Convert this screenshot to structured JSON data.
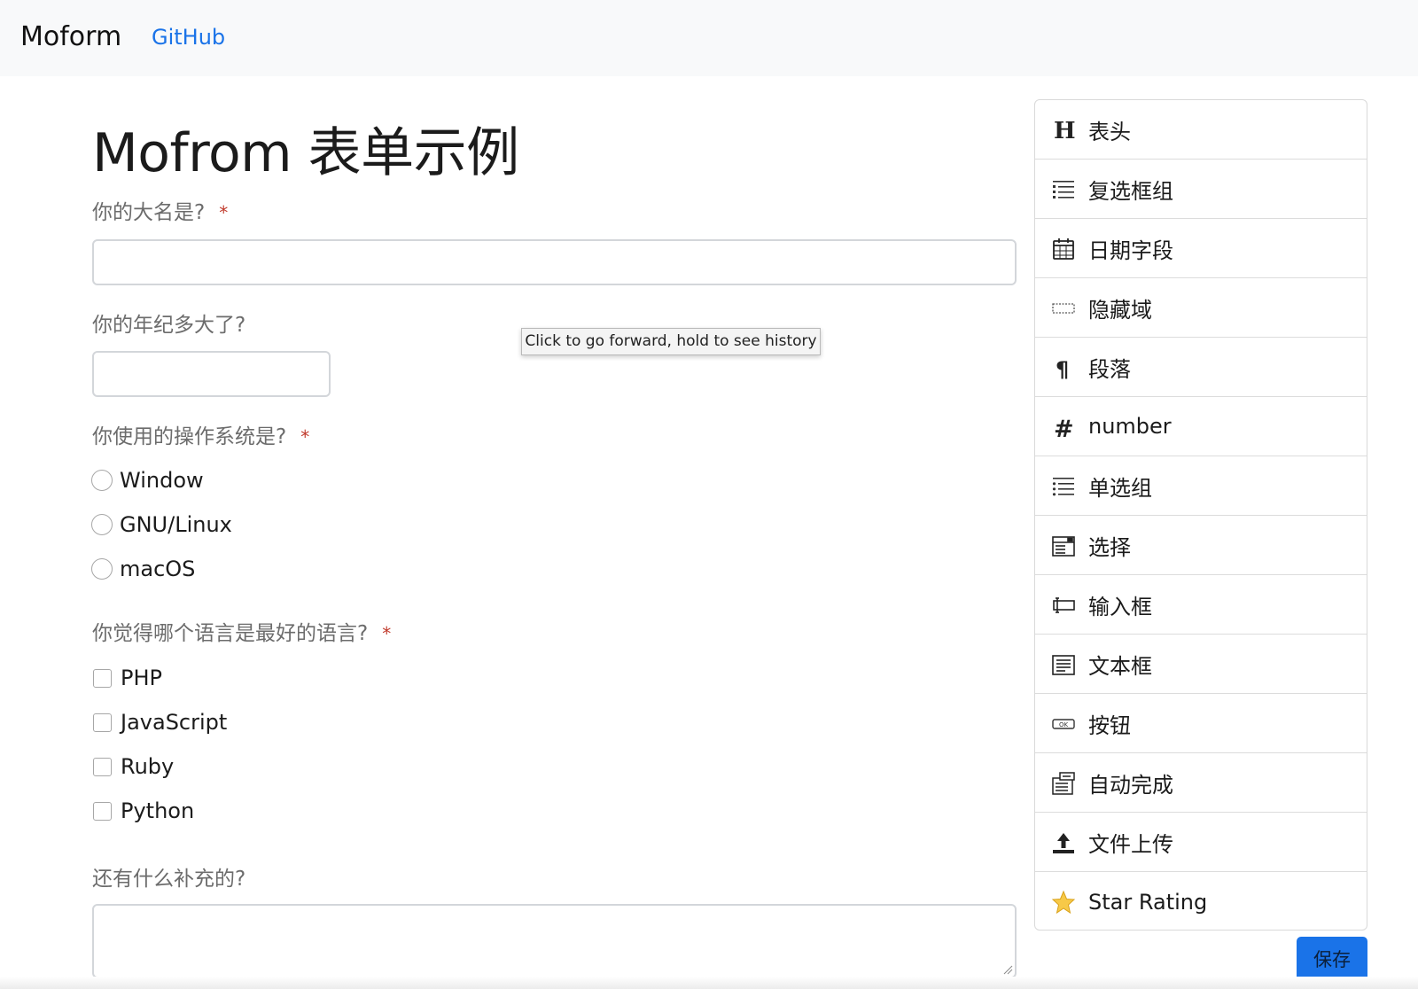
{
  "navbar": {
    "brand": "Moform",
    "github": "GitHub"
  },
  "form": {
    "title": "Mofrom 表单示例",
    "q_name": {
      "label": "你的大名是?",
      "required_mark": "*",
      "value": ""
    },
    "q_age": {
      "label": "你的年纪多大了?",
      "value": ""
    },
    "q_os": {
      "label": "你使用的操作系统是?",
      "required_mark": "*",
      "options": [
        "Window",
        "GNU/Linux",
        "macOS"
      ]
    },
    "q_lang": {
      "label": "你觉得哪个语言是最好的语言?",
      "required_mark": "*",
      "options": [
        "PHP",
        "JavaScript",
        "Ruby",
        "Python"
      ]
    },
    "q_more": {
      "label": "还有什么补充的?",
      "value": ""
    }
  },
  "tooltip": {
    "text": "Click to go forward, hold to see history"
  },
  "palette": {
    "items": [
      {
        "label": "表头",
        "icon": "header-icon"
      },
      {
        "label": "复选框组",
        "icon": "checkbox-group-icon"
      },
      {
        "label": "日期字段",
        "icon": "calendar-icon"
      },
      {
        "label": "隐藏域",
        "icon": "hidden-field-icon"
      },
      {
        "label": "段落",
        "icon": "paragraph-icon"
      },
      {
        "label": "number",
        "icon": "number-icon"
      },
      {
        "label": "单选组",
        "icon": "radio-group-icon"
      },
      {
        "label": "选择",
        "icon": "select-icon"
      },
      {
        "label": "输入框",
        "icon": "text-input-icon"
      },
      {
        "label": "文本框",
        "icon": "textarea-icon"
      },
      {
        "label": "按钮",
        "icon": "button-icon"
      },
      {
        "label": "自动完成",
        "icon": "autocomplete-icon"
      },
      {
        "label": "文件上传",
        "icon": "upload-icon"
      },
      {
        "label": "Star Rating",
        "icon": "star-icon"
      }
    ]
  },
  "actions": {
    "save": "保存"
  },
  "colors": {
    "link": "#1a73e8",
    "required": "#c0392b",
    "navbar_bg": "#f8f9fa",
    "save_bg": "#1a73e8"
  }
}
